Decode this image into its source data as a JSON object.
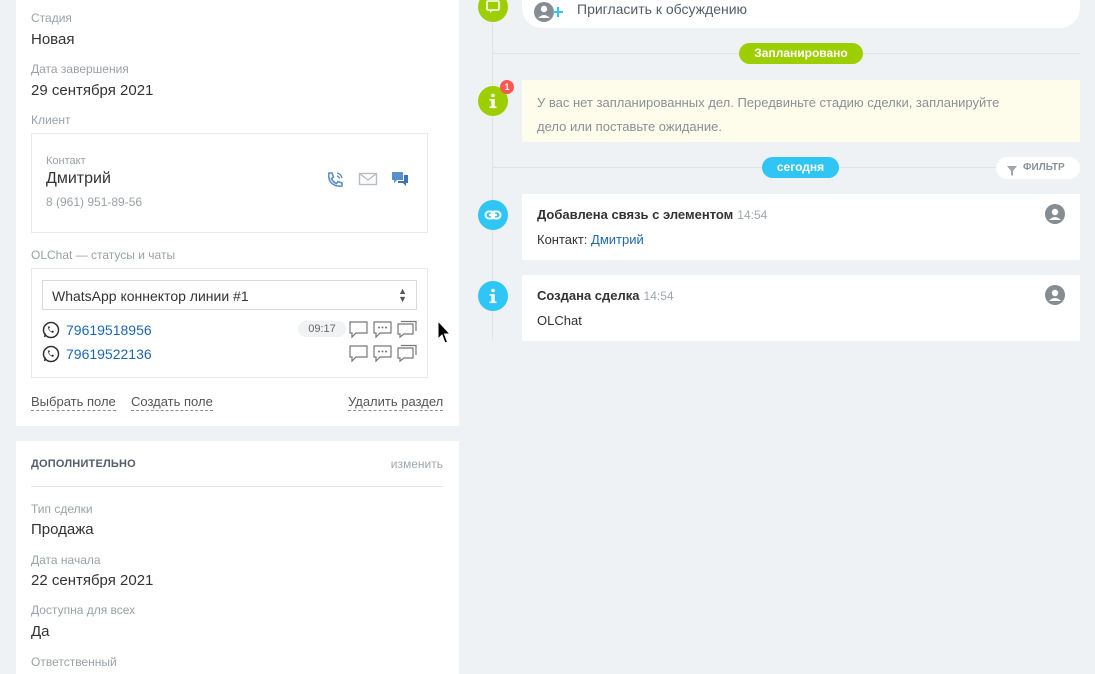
{
  "left": {
    "stage_label": "Стадия",
    "stage_value": "Новая",
    "end_date_label": "Дата завершения",
    "end_date_value": "29 сентября 2021",
    "client_label": "Клиент",
    "contact": {
      "label": "Контакт",
      "name": "Дмитрий",
      "phone": "8 (961) 951-89-56",
      "icons": [
        "phone-icon",
        "mail-icon",
        "chat-icon"
      ]
    },
    "olchat_label": "OLChat — статусы и чаты",
    "olchat": {
      "select_value": "WhatsApp коннектор линии #1",
      "phones": [
        {
          "number": "79619518956",
          "time": "09:17"
        },
        {
          "number": "79619522136",
          "time": ""
        }
      ]
    },
    "links": {
      "choose_field": "Выбрать поле",
      "create_field": "Создать поле",
      "delete_section": "Удалить раздел"
    },
    "extra": {
      "title": "ДОПОЛНИТЕЛЬНО",
      "edit": "изменить",
      "deal_type_label": "Тип сделки",
      "deal_type_value": "Продажа",
      "start_date_label": "Дата начала",
      "start_date_value": "22 сентября 2021",
      "available_label": "Доступна для всех",
      "available_value": "Да",
      "responsible_label": "Ответственный"
    }
  },
  "timeline": {
    "invite_text": "Пригласить к обсуждению",
    "planned_pill": "Запланировано",
    "planned_badge": "1",
    "planned_notice": "У вас нет запланированных дел. Передвиньте стадию сделки, запланируйте дело или поставьте ожидание.",
    "today_pill": "сегодня",
    "filter_label": "ФИЛЬТР",
    "entries": [
      {
        "title": "Добавлена связь с элементом",
        "time": "14:54",
        "body_prefix": "Контакт: ",
        "body_link": "Дмитрий"
      },
      {
        "title": "Создана сделка",
        "time": "14:54",
        "body": "OLChat"
      }
    ]
  },
  "colors": {
    "green": "#9dcf00",
    "blue": "#2fc6f6",
    "link": "#2067b0",
    "notice_bg": "#fefdeb"
  }
}
